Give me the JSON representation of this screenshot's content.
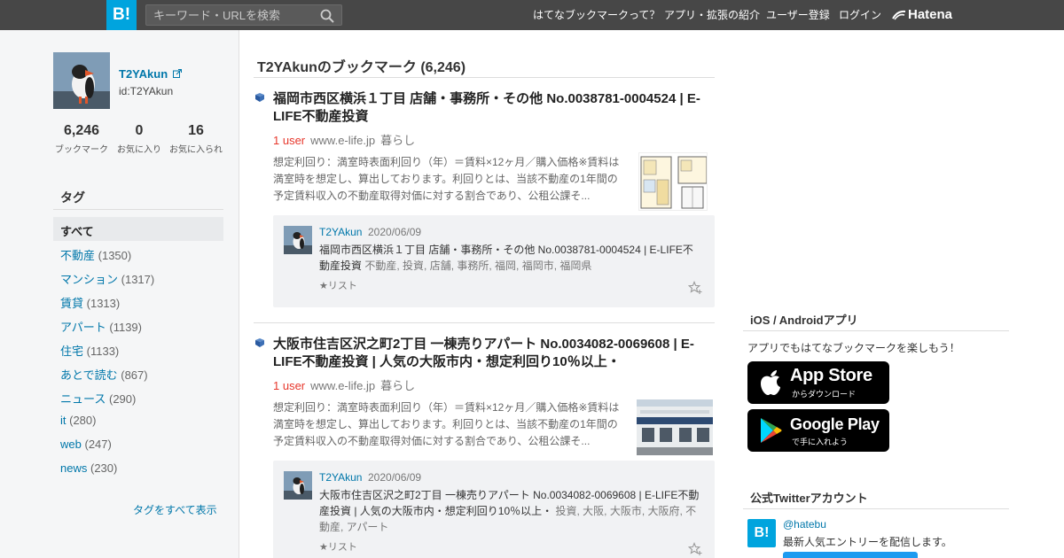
{
  "header": {
    "logo": "B!",
    "search_placeholder": "キーワード・URLを検索",
    "nav": [
      "はてなブックマークって？",
      "アプリ・拡張の紹介",
      "ユーザー登録",
      "ログイン"
    ],
    "brand": "Hatena"
  },
  "profile": {
    "name": "T2YAkun",
    "id": "id:T2YAkun",
    "stats": [
      {
        "num": "6,246",
        "label": "ブックマーク"
      },
      {
        "num": "0",
        "label": "お気に入り"
      },
      {
        "num": "16",
        "label": "お気に入られ"
      }
    ]
  },
  "tags": {
    "heading": "タグ",
    "all": "すべて",
    "items": [
      {
        "name": "不動産",
        "count": "(1350)"
      },
      {
        "name": "マンション",
        "count": "(1317)"
      },
      {
        "name": "賃貸",
        "count": "(1313)"
      },
      {
        "name": "アパート",
        "count": "(1139)"
      },
      {
        "name": "住宅",
        "count": "(1133)"
      },
      {
        "name": "あとで読む",
        "count": "(867)"
      },
      {
        "name": "ニュース",
        "count": "(290)"
      },
      {
        "name": "it",
        "count": "(280)"
      },
      {
        "name": "web",
        "count": "(247)"
      },
      {
        "name": "news",
        "count": "(230)"
      }
    ],
    "show_all": "タグをすべて表示"
  },
  "main": {
    "title": "T2YAkunのブックマーク (6,246)",
    "entries": [
      {
        "title": "福岡市西区横浜１丁目 店舗・事務所・その他 No.0038781-0004524 | E-LIFE不動産投資",
        "users": "1 user",
        "domain": "www.e-life.jp",
        "category": "暮らし",
        "desc": "想定利回り：満室時表面利回り（年）＝賃料×12ヶ月／購入価格※賃料は満室時を想定し、算出しております。利回りとは、当該不動産の1年間の予定賃料収入の不動産取得対価に対する割合であり、公租公課そ...",
        "comment": {
          "user": "T2YAkun",
          "date": "2020/06/09",
          "text": "福岡市西区横浜１丁目 店舗・事務所・その他 No.0038781-0004524 | E-LIFE不動産投資",
          "tags": "不動産, 投資, 店舗, 事務所, 福岡, 福岡市, 福岡県",
          "list": "★リスト"
        }
      },
      {
        "title": "大阪市住吉区沢之町2丁目 一棟売りアパート No.0034082-0069608 | E-LIFE不動産投資 | 人気の大阪市内・想定利回り10％以上・",
        "users": "1 user",
        "domain": "www.e-life.jp",
        "category": "暮らし",
        "desc": "想定利回り：満室時表面利回り（年）＝賃料×12ヶ月／購入価格※賃料は満室時を想定し、算出しております。利回りとは、当該不動産の1年間の予定賃料収入の不動産取得対価に対する割合であり、公租公課そ...",
        "comment": {
          "user": "T2YAkun",
          "date": "2020/06/09",
          "text": "大阪市住吉区沢之町2丁目 一棟売りアパート No.0034082-0069608 | E-LIFE不動産投資 | 人気の大阪市内・想定利回り10％以上・",
          "tags": "投資, 大阪, 大阪市, 大阪府, 不動産, アパート",
          "list": "★リスト"
        }
      }
    ]
  },
  "right": {
    "apps_heading": "iOS / Androidアプリ",
    "apps_text": "アプリでもはてなブックマークを楽しもう！",
    "app_store": {
      "big": "App Store",
      "small": "からダウンロード"
    },
    "google_play": {
      "big": "Google Play",
      "small": "で手に入れよう"
    },
    "twitter_heading": "公式Twitterアカウント",
    "twitter_handle": "@hatebu",
    "twitter_desc": "最新人気エントリーを配信します。"
  },
  "colors": {
    "accent": "#00a4de",
    "link": "#0077aa",
    "users": "#e7382d",
    "header_bg": "#474747"
  }
}
